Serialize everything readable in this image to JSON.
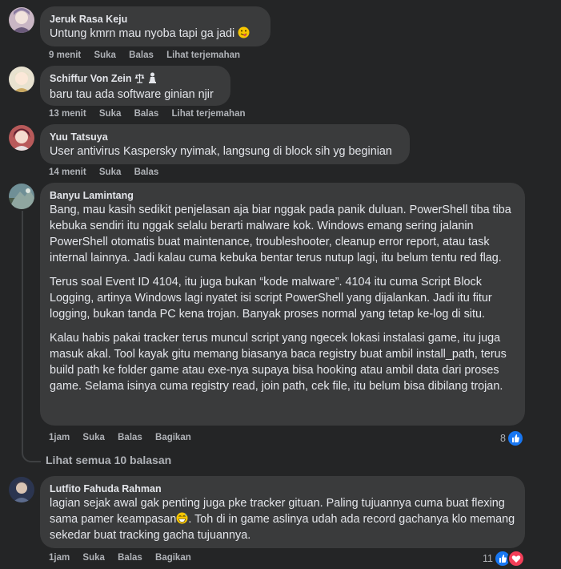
{
  "comments": [
    {
      "author": "Jeruk Rasa Keju",
      "text": "Untung kmrn mau nyoba tapi ga jadi",
      "time": "9 menit",
      "like": "Suka",
      "reply": "Balas",
      "translate": "Lihat terjemahan",
      "emoji": "smiley-tongue-icon"
    },
    {
      "author": "Schiffur Von Zein",
      "author_badges": [
        "scales-icon",
        "pawn-icon"
      ],
      "text": "baru tau ada software ginian njir",
      "time": "13 menit",
      "like": "Suka",
      "reply": "Balas",
      "translate": "Lihat terjemahan"
    },
    {
      "author": "Yuu Tatsuya",
      "text": "User antivirus Kaspersky nyimak, langsung di block sih yg beginian",
      "time": "14 menit",
      "like": "Suka",
      "reply": "Balas"
    },
    {
      "author": "Banyu Lamintang",
      "paragraphs": [
        "Bang, mau kasih sedikit penjelasan aja biar nggak pada panik duluan. PowerShell tiba tiba kebuka sendiri itu nggak selalu berarti malware kok. Windows emang sering jalanin PowerShell otomatis buat maintenance, troubleshooter, cleanup error report, atau task internal lainnya. Jadi kalau cuma kebuka bentar terus nutup lagi, itu belum tentu red flag.",
        "Terus soal Event ID 4104, itu juga bukan “kode malware”. 4104 itu cuma Script Block Logging, artinya Windows lagi nyatet isi script PowerShell yang dijalankan. Jadi itu fitur logging, bukan tanda PC kena trojan. Banyak proses normal yang tetap ke-log di situ.",
        "Kalau habis pakai tracker terus muncul script yang ngecek lokasi instalasi game, itu juga masuk akal. Tool kayak gitu memang biasanya baca registry buat ambil install_path, terus build path ke folder game atau exe-nya supaya bisa hooking atau ambil data dari proses game. Selama isinya cuma registry read, join path, cek file, itu belum bisa dibilang trojan."
      ],
      "time": "1jam",
      "like": "Suka",
      "reply": "Balas",
      "share": "Bagikan",
      "reaction_count": "8",
      "reaction_icons": [
        "like-icon"
      ]
    },
    {
      "author": "Lutfito Fahuda Rahman",
      "text_before_emoji": "lagian sejak awal gak penting juga pke tracker gituan. Paling tujuannya cuma buat flexing sama pamer keampasan",
      "emoji": "grin-sweat-icon",
      "text_after_emoji": ". Toh di in game aslinya udah ada record gachanya klo memang sekedar buat tracking gacha tujuannya.",
      "time": "1jam",
      "like": "Suka",
      "reply": "Balas",
      "share": "Bagikan",
      "reaction_count": "11",
      "reaction_icons": [
        "like-icon",
        "love-icon"
      ]
    }
  ],
  "see_all_replies": "Lihat semua 10 balasan",
  "colors": {
    "background": "#242526",
    "bubble": "#3a3b3c",
    "text": "#e4e6eb",
    "muted": "#b0b3b8",
    "like": "#1877f2",
    "love": "#f33e58"
  }
}
